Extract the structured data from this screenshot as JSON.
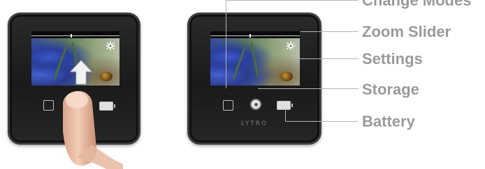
{
  "labels": {
    "change_modes": "Change Modes",
    "zoom_slider": "Zoom Slider",
    "settings": "Settings",
    "storage": "Storage",
    "battery": "Battery"
  },
  "device": {
    "brand": "LYTRO"
  },
  "icons": {
    "settings": "gear-icon",
    "mode": "square-icon",
    "storage": "storage-icon",
    "battery": "battery-icon",
    "gesture": "finger-swipe-up"
  },
  "colors": {
    "label_text": "#9a9a9a",
    "device_body": "#1f1f1f",
    "leader_line": "#b5b5b5"
  }
}
